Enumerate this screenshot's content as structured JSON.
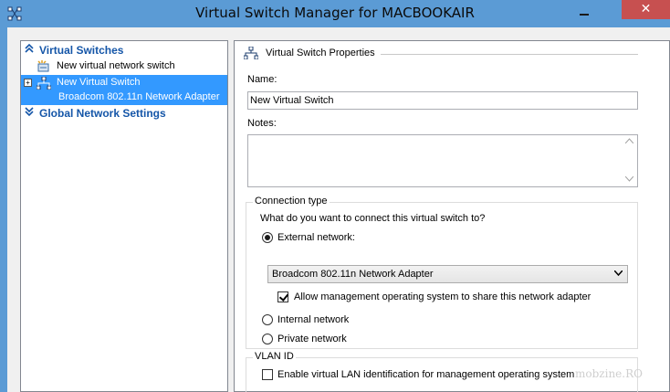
{
  "window": {
    "title": "Virtual Switch Manager for MACBOOKAIR",
    "close_glyph": "✕"
  },
  "tree": {
    "virtual_switches_heading": "Virtual Switches",
    "new_switch_item": "New virtual network switch",
    "selected_switch": {
      "name": "New Virtual Switch",
      "adapter": "Broadcom 802.11n Network Adapter",
      "expander": "+"
    },
    "global_settings_heading": "Global Network Settings"
  },
  "properties": {
    "header": "Virtual Switch Properties",
    "name_label": "Name:",
    "name_value": "New Virtual Switch",
    "notes_label": "Notes:",
    "notes_value": "",
    "connection_type": {
      "title": "Connection type",
      "question": "What do you want to connect this virtual switch to?",
      "external_label": "External network:",
      "external_adapter": "Broadcom 802.11n Network Adapter",
      "allow_mgmt_label": "Allow management operating system to share this network adapter",
      "internal_label": "Internal network",
      "private_label": "Private network",
      "selected": "external",
      "allow_mgmt_checked": true
    },
    "vlan": {
      "title": "VLAN ID",
      "enable_label": "Enable virtual LAN identification for management operating system",
      "enabled": false
    }
  },
  "watermark": "mobzine.RO",
  "colors": {
    "titlebar": "#5b9bd5",
    "selection": "#3399ff",
    "heading": "#1556a8",
    "close": "#c75050"
  },
  "icons": {
    "app": "network-switch-icon",
    "new_switch": "new-switch-icon",
    "switch": "virtual-switch-icon",
    "expand": "chevron-up-icon",
    "collapse": "chevron-down-icon"
  }
}
